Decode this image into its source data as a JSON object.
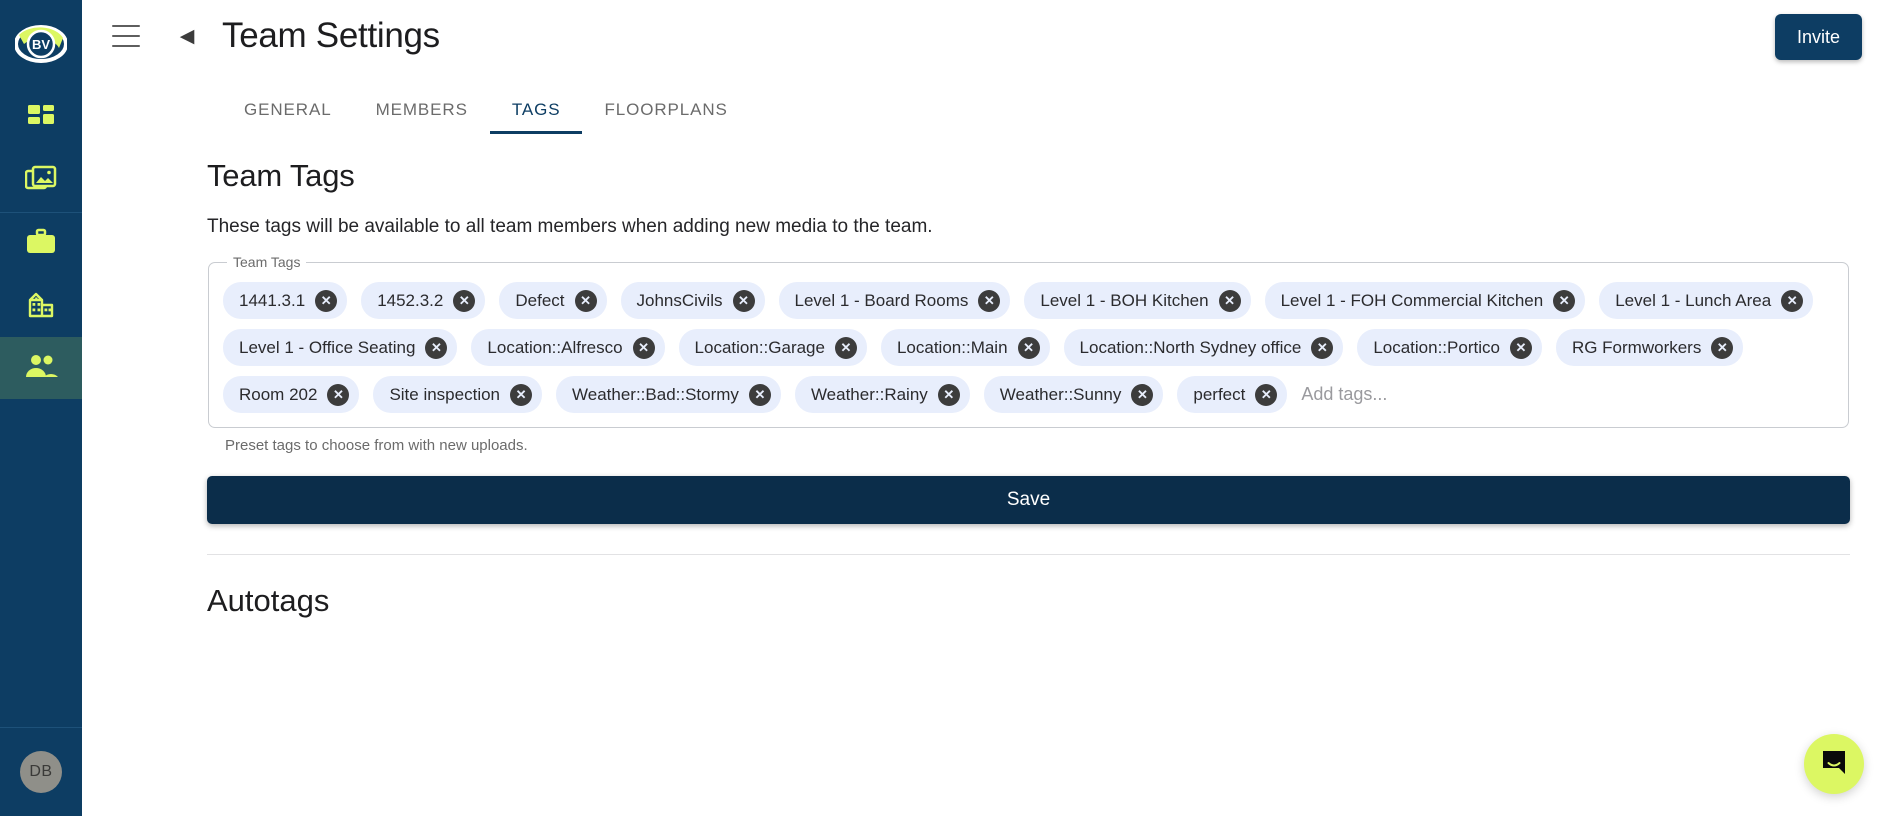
{
  "sidebar": {
    "logo": {
      "name": "bv-logo",
      "text": "BV"
    },
    "items": [
      {
        "name": "dashboard",
        "icon": "grid-icon",
        "active": false
      },
      {
        "name": "media",
        "icon": "photo-library-icon",
        "active": false
      },
      {
        "name": "projects",
        "icon": "briefcase-icon",
        "active": false
      },
      {
        "name": "company",
        "icon": "building-icon",
        "active": false
      },
      {
        "name": "team",
        "icon": "people-icon",
        "active": true
      }
    ],
    "avatar_initials": "DB"
  },
  "topbar": {
    "menu_icon": "hamburger-icon",
    "back_icon": "chevron-left-icon",
    "title": "Team Settings",
    "invite_label": "Invite"
  },
  "tabs": [
    {
      "label": "GENERAL",
      "active": false
    },
    {
      "label": "MEMBERS",
      "active": false
    },
    {
      "label": "TAGS",
      "active": true
    },
    {
      "label": "FLOORPLANS",
      "active": false
    }
  ],
  "team_tags": {
    "heading": "Team Tags",
    "description": "These tags will be available to all team members when adding new media to the team.",
    "fieldset_legend": "Team Tags",
    "input_placeholder": "Add tags...",
    "helper_text": "Preset tags to choose from with new uploads.",
    "save_label": "Save",
    "remove_glyph": "✕",
    "tags": [
      "1441.3.1",
      "1452.3.2",
      "Defect",
      "JohnsCivils",
      "Level 1 - Board Rooms",
      "Level 1 - BOH Kitchen",
      "Level 1 - FOH Commercial Kitchen",
      "Level 1 - Lunch Area",
      "Level 1 - Office Seating",
      "Location::Alfresco",
      "Location::Garage",
      "Location::Main",
      "Location::North Sydney office",
      "Location::Portico",
      "RG Formworkers",
      "Room 202",
      "Site inspection",
      "Weather::Bad::Stormy",
      "Weather::Rainy",
      "Weather::Sunny",
      "perfect"
    ]
  },
  "autotags": {
    "heading": "Autotags"
  },
  "chat": {
    "icon": "chat-bubble-icon"
  },
  "colors": {
    "sidebar_bg": "#0d3d63",
    "sidebar_active": "#2d5c5f",
    "accent_lime": "#dcf763",
    "brand_navy": "#0d3d63",
    "save_navy": "#0b2d4a",
    "chip_bg": "#e8eefc"
  }
}
